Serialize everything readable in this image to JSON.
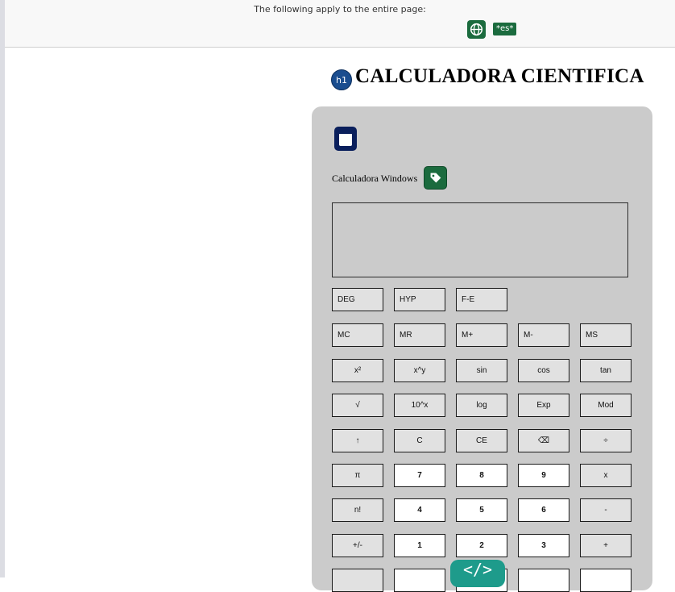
{
  "header": {
    "applies_text": "The following apply to the entire page:",
    "lang_badge": "*es*"
  },
  "title": {
    "badge": "h1",
    "text": "CALCULADORA CIENTIFICA"
  },
  "calculator": {
    "label": "Calculadora Windows",
    "modes": [
      "DEG",
      "HYP",
      "F-E"
    ],
    "memory": [
      "MC",
      "MR",
      "M+",
      "M-",
      "MS"
    ],
    "rows": [
      [
        "x²",
        "x^y",
        "sin",
        "cos",
        "tan"
      ],
      [
        "√",
        "10^x",
        "log",
        "Exp",
        "Mod"
      ],
      [
        "↑",
        "C",
        "CE",
        "⌫",
        "÷"
      ],
      [
        "π",
        "7",
        "8",
        "9",
        "x"
      ],
      [
        "n!",
        "4",
        "5",
        "6",
        "-"
      ],
      [
        "+/-",
        "1",
        "2",
        "3",
        "+"
      ],
      [
        "",
        "",
        "",
        "",
        ""
      ]
    ]
  },
  "overlay": {
    "code_badge": "</>"
  },
  "colors": {
    "accent_green": "#1b6b3e",
    "heading_badge_blue": "#1a4d8f",
    "code_badge_teal": "#1e9b8b"
  }
}
